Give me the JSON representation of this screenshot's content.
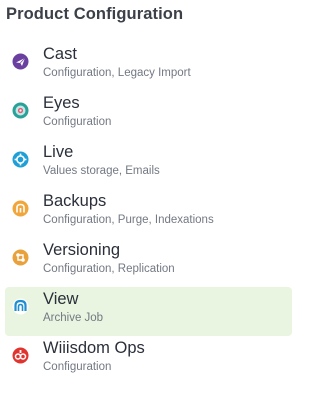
{
  "title": "Product Configuration",
  "items": [
    {
      "label": "Cast",
      "sublabel": "Configuration, Legacy Import",
      "icon": "cast-icon",
      "color": "#6a3fa0",
      "active": false
    },
    {
      "label": "Eyes",
      "sublabel": "Configuration",
      "icon": "eyes-icon",
      "color": "#2aa198",
      "active": false
    },
    {
      "label": "Live",
      "sublabel": "Values storage, Emails",
      "icon": "live-icon",
      "color": "#1e9fd6",
      "active": false
    },
    {
      "label": "Backups",
      "sublabel": "Configuration, Purge, Indexations",
      "icon": "backups-icon",
      "color": "#f0a63a",
      "active": false
    },
    {
      "label": "Versioning",
      "sublabel": "Configuration, Replication",
      "icon": "versioning-icon",
      "color": "#e9a23b",
      "active": false
    },
    {
      "label": "View",
      "sublabel": "Archive Job",
      "icon": "view-icon",
      "color": "#1f8fd1",
      "active": true
    },
    {
      "label": "Wiiisdom Ops",
      "sublabel": "Configuration",
      "icon": "wiiisdom-ops-icon",
      "color": "#e0342f",
      "active": false
    }
  ],
  "colors": {
    "active_background": "#e9f5e0",
    "title_text": "#3c4049",
    "sublabel_text": "#737883"
  }
}
